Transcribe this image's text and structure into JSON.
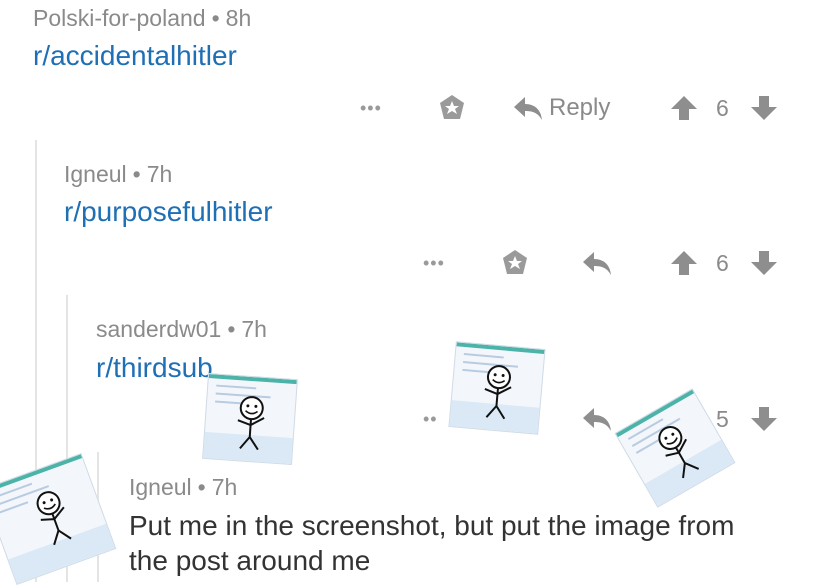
{
  "comments": [
    {
      "author": "Polski-for-poland",
      "age": "8h",
      "text": "r/accidentalhitler",
      "reply_label": "Reply",
      "score": "6"
    },
    {
      "author": "Igneul",
      "age": "7h",
      "text": "r/purposefulhitler",
      "score": "6"
    },
    {
      "author": "sanderdw01",
      "age": "7h",
      "text": "r/thirdsub",
      "score": "5"
    },
    {
      "author": "Igneul",
      "age": "7h",
      "body": "Put me in the screenshot, but put the image from the post around me"
    }
  ],
  "separator": "•",
  "colors": {
    "link": "#1f6fb5",
    "meta": "#8a8a8a",
    "thread_line": "#e4e4e4"
  },
  "icons": [
    "more-dots-icon",
    "star-badge-icon",
    "reply-arrow-icon",
    "upvote-arrow-icon",
    "downvote-arrow-icon",
    "stick-figure-sticker"
  ]
}
